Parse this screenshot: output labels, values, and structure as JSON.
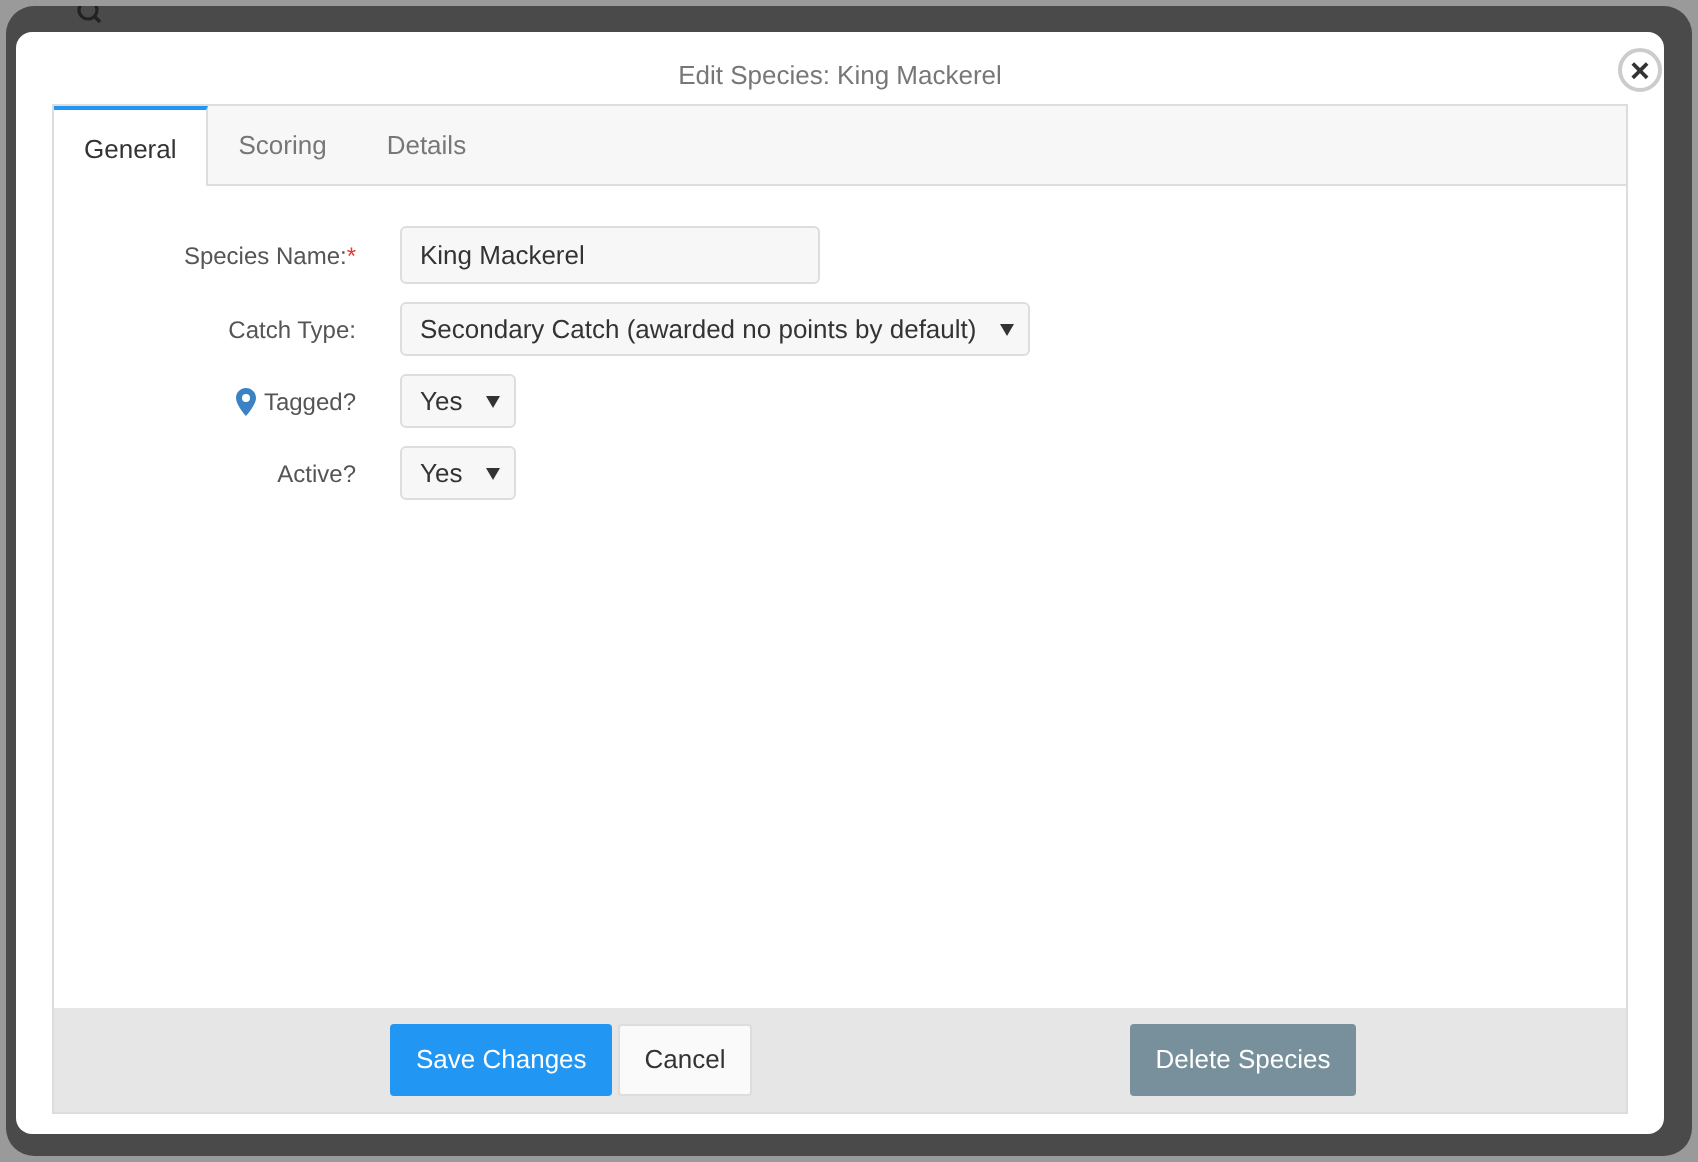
{
  "dialog": {
    "title": "Edit Species: King Mackerel",
    "close": "×"
  },
  "tabs": [
    {
      "label": "General",
      "selected": true
    },
    {
      "label": "Scoring",
      "selected": false
    },
    {
      "label": "Details",
      "selected": false
    }
  ],
  "fields": [
    {
      "kind": "text",
      "label": "Species Name:",
      "required_mark": "*",
      "marker_icon": false,
      "value": "King Mackerel"
    },
    {
      "kind": "select",
      "label": "Catch Type:",
      "marker_icon": false,
      "value": "Secondary Catch (awarded no points by default)"
    },
    {
      "kind": "select",
      "label": "Tagged?",
      "marker_icon": true,
      "value": "Yes"
    },
    {
      "kind": "select",
      "label": "Active?",
      "marker_icon": false,
      "value": "Yes"
    }
  ],
  "buttons": [
    {
      "kind": "primary",
      "label": "Save Changes"
    },
    {
      "kind": "default",
      "label": "Cancel"
    },
    {
      "kind": "danger",
      "label": "Delete Species"
    }
  ]
}
